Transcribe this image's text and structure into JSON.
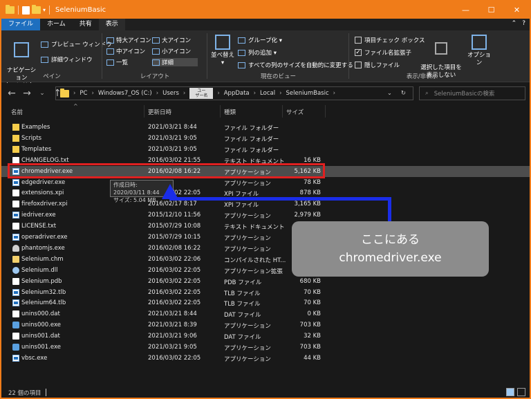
{
  "window": {
    "title": "SeleniumBasic",
    "minimize": "—",
    "maximize": "☐",
    "close": "✕"
  },
  "menu": {
    "items": [
      "ファイル",
      "ホーム",
      "共有",
      "表示"
    ],
    "help_up": "⌃",
    "help": "?"
  },
  "ribbon": {
    "pane": {
      "label": "ペイン",
      "navpane": "ナビゲーション\nウィンドウ ▾",
      "preview": "プレビュー ウィンドウ",
      "details": "詳細ウィンドウ"
    },
    "layout": {
      "label": "レイアウト",
      "items": [
        "特大アイコン",
        "大アイコン",
        "中アイコン",
        "小アイコン",
        "一覧",
        "詳細"
      ]
    },
    "view": {
      "label": "現在のビュー",
      "sort": "並べ替え ▾",
      "group": "グループ化 ▾",
      "addcol": "列の追加 ▾",
      "fitcols": "すべての列のサイズを自動的に変更する"
    },
    "showhide": {
      "label": "表示/非表示",
      "checkboxes": "項目チェック ボックス",
      "ext": "ファイル名拡張子",
      "hidden": "隠しファイル",
      "hide_selected": "選択した項目を\n表示しない",
      "options": "オプション"
    }
  },
  "address": {
    "crumbs": [
      "PC",
      "Windows7_OS (C:)",
      "Users"
    ],
    "user": "ユー\nザー名",
    "crumbs2": [
      "AppData",
      "Local",
      "SeleniumBasic"
    ],
    "search_placeholder": "SeleniumBasicの検索"
  },
  "columns": {
    "name": "名前",
    "date": "更新日時",
    "type": "種類",
    "size": "サイズ"
  },
  "files": [
    {
      "name": "Examples",
      "date": "2021/03/21 8:44",
      "type": "ファイル フォルダー",
      "size": "",
      "icon": "folder"
    },
    {
      "name": "Scripts",
      "date": "2021/03/21 9:05",
      "type": "ファイル フォルダー",
      "size": "",
      "icon": "folder"
    },
    {
      "name": "Templates",
      "date": "2021/03/21 9:05",
      "type": "ファイル フォルダー",
      "size": "",
      "icon": "folder"
    },
    {
      "name": "CHANGELOG.txt",
      "date": "2016/03/02 21:55",
      "type": "テキスト ドキュメント",
      "size": "16 KB",
      "icon": "doc"
    },
    {
      "name": "chromedriver.exe",
      "date": "2016/02/08 16:22",
      "type": "アプリケーション",
      "size": "5,162 KB",
      "icon": "exe"
    },
    {
      "name": "edgedriver.exe",
      "date": "",
      "type": "アプリケーション",
      "size": "78 KB",
      "icon": "exe"
    },
    {
      "name": "extensions.xpi",
      "date": "2016/03/02 22:05",
      "type": "XPI ファイル",
      "size": "878 KB",
      "icon": "doc"
    },
    {
      "name": "firefoxdriver.xpi",
      "date": "2016/02/17 8:17",
      "type": "XPI ファイル",
      "size": "3,165 KB",
      "icon": "doc"
    },
    {
      "name": "iedriver.exe",
      "date": "2015/12/10 11:56",
      "type": "アプリケーション",
      "size": "2,979 KB",
      "icon": "exe"
    },
    {
      "name": "LICENSE.txt",
      "date": "2015/07/29 10:08",
      "type": "テキスト ドキュメント",
      "size": "",
      "icon": "doc"
    },
    {
      "name": "operadriver.exe",
      "date": "2015/07/29 10:15",
      "type": "アプリケーション",
      "size": "",
      "icon": "exe"
    },
    {
      "name": "phantomjs.exe",
      "date": "2016/02/08 16:22",
      "type": "アプリケーション",
      "size": "",
      "icon": "ghost"
    },
    {
      "name": "Selenium.chm",
      "date": "2016/03/02 22:06",
      "type": "コンパイルされた HT...",
      "size": "",
      "icon": "chm"
    },
    {
      "name": "Selenium.dll",
      "date": "2016/03/02 22:05",
      "type": "アプリケーション拡張",
      "size": "",
      "icon": "gear"
    },
    {
      "name": "Selenium.pdb",
      "date": "2016/03/02 22:05",
      "type": "PDB ファイル",
      "size": "680 KB",
      "icon": "doc"
    },
    {
      "name": "Selenium32.tlb",
      "date": "2016/03/02 22:05",
      "type": "TLB ファイル",
      "size": "70 KB",
      "icon": "exe"
    },
    {
      "name": "Selenium64.tlb",
      "date": "2016/03/02 22:05",
      "type": "TLB ファイル",
      "size": "70 KB",
      "icon": "exe"
    },
    {
      "name": "unins000.dat",
      "date": "2021/03/21 8:44",
      "type": "DAT ファイル",
      "size": "0 KB",
      "icon": "doc"
    },
    {
      "name": "unins000.exe",
      "date": "2021/03/21 8:39",
      "type": "アプリケーション",
      "size": "703 KB",
      "icon": "inst"
    },
    {
      "name": "unins001.dat",
      "date": "2021/03/21 9:06",
      "type": "DAT ファイル",
      "size": "32 KB",
      "icon": "doc"
    },
    {
      "name": "unins001.exe",
      "date": "2021/03/21 9:05",
      "type": "アプリケーション",
      "size": "703 KB",
      "icon": "inst"
    },
    {
      "name": "vbsc.exe",
      "date": "2016/03/02 22:05",
      "type": "アプリケーション",
      "size": "44 KB",
      "icon": "exe"
    }
  ],
  "tooltip": {
    "line1": "作成日時: 2020/03/11 8:44",
    "line2": "サイズ: 5.04 MB"
  },
  "callout": {
    "line1": "ここにある",
    "line2": "chromedriver.exe"
  },
  "status": {
    "count": "22 個の項目"
  },
  "colors": {
    "accent": "#f07c19",
    "highlight": "#e02020",
    "arrow": "#1a2de8"
  }
}
